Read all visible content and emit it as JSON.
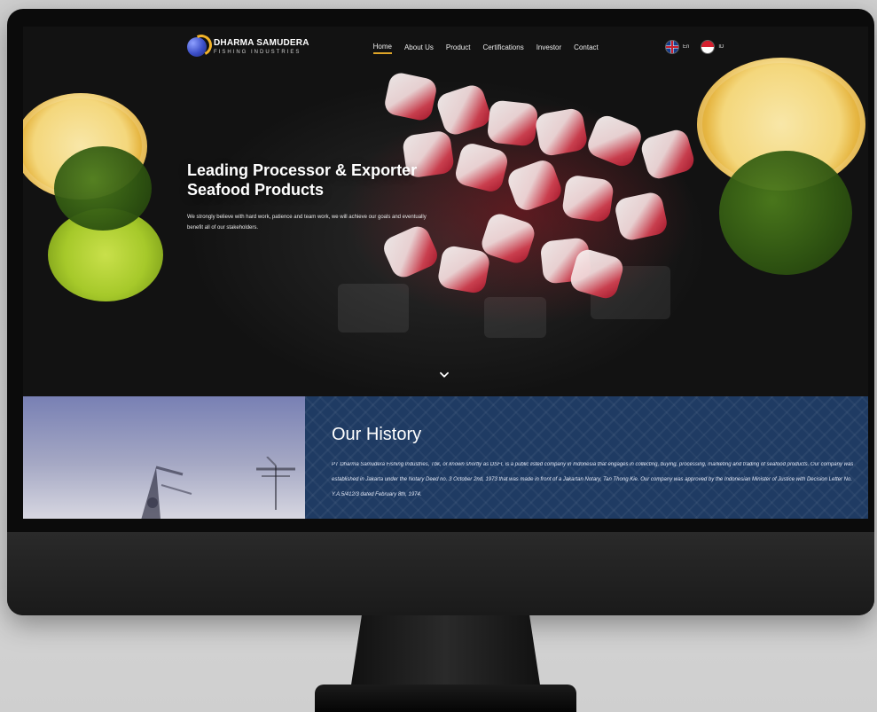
{
  "nav": {
    "brand_name": "DHARMA SAMUDERA",
    "brand_tagline": "FISHING INDUSTRIES",
    "items": [
      {
        "label": "Home",
        "active": true
      },
      {
        "label": "About Us",
        "active": false
      },
      {
        "label": "Product",
        "active": false
      },
      {
        "label": "Certifications",
        "active": false
      },
      {
        "label": "Investor",
        "active": false
      },
      {
        "label": "Contact",
        "active": false
      }
    ],
    "languages": [
      {
        "code": "EN",
        "label": "En",
        "flag_icon": "uk-flag-icon"
      },
      {
        "code": "ID",
        "label": "ID",
        "flag_icon": "indonesia-flag-icon"
      }
    ]
  },
  "hero": {
    "title": "Leading Processor & Exporter Seafood Products",
    "subtitle": "We strongly believe with hard work, patience and team work, we will achieve our goals and eventually benefit all of our stakeholders.",
    "scroll_icon": "chevron-down-icon"
  },
  "history": {
    "title": "Our History",
    "text": "PT Dharma Samudera Fishing Industries, Tbk, or known shortly as DSFI, is a public listed company in Indonesia that engages in collecting, buying, processing, marketing and trading of seafood products. Our company was established in Jakarta under the Notary Deed no. 3 October 2nd, 1973 that was made in front of a Jakartan Notary, Tan Thong Kie. Our company was approved by the Indonesian Minister of Justice with Decision Letter No. Y.A.5/412/3 dated February 8th, 1974."
  },
  "colors": {
    "accent": "#f0b22a",
    "history_panel": "#1f3b63"
  }
}
